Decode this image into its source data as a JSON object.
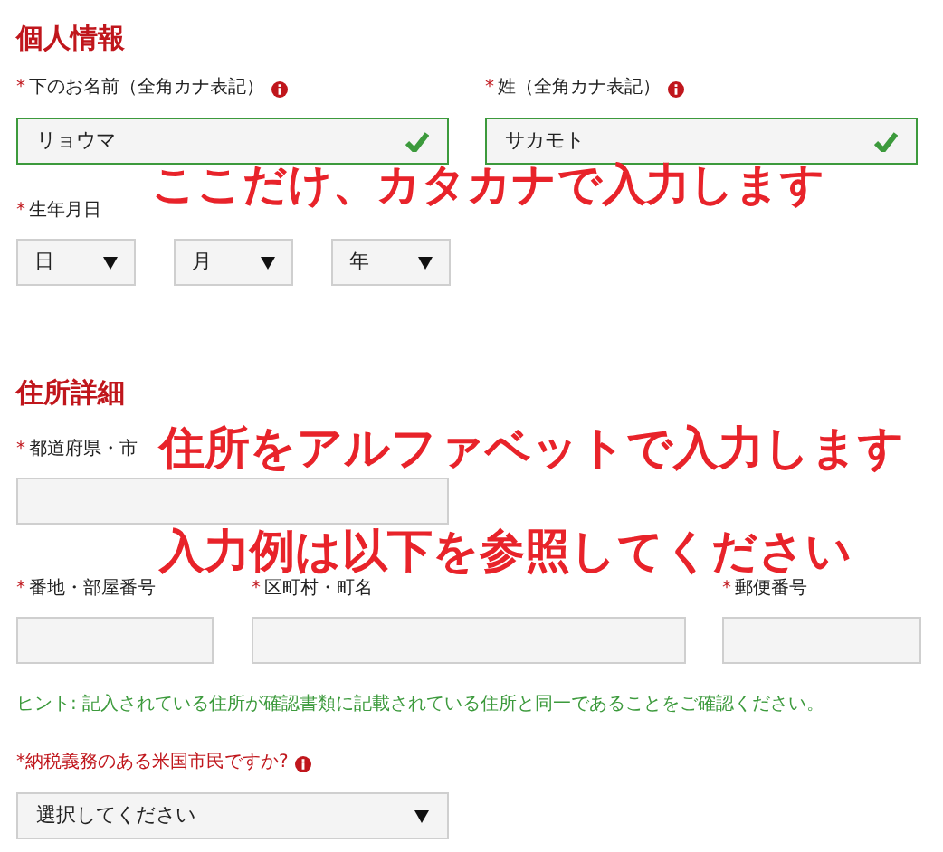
{
  "personal": {
    "title": "個人情報",
    "name_fields": [
      {
        "mark": "*",
        "label": "下のお名前（全角カナ表記）",
        "info": true,
        "value": "リョウマ",
        "valid": true
      },
      {
        "mark": "*",
        "label": "姓（全角カナ表記）",
        "info": true,
        "value": "サカモト",
        "valid": true
      }
    ],
    "birthdate": {
      "mark": "*",
      "label": "生年月日",
      "selects": [
        "日",
        "月",
        "年"
      ]
    },
    "annotation": "ここだけ、カタカナで入力します"
  },
  "address": {
    "title": "住所詳細",
    "city": {
      "mark": "*",
      "label": "都道府県・市"
    },
    "row": [
      {
        "mark": "*",
        "label": "番地・部屋番号"
      },
      {
        "mark": "*",
        "label": "区町村・町名"
      },
      {
        "mark": "*",
        "label": "郵便番号"
      }
    ],
    "annotation_lines": [
      "住所をアルファベットで入力します",
      "入力例は以下を参照してください"
    ],
    "hint": "ヒント: 記入されている住所が確認書類に記載されている住所と同一であることをご確認ください。"
  },
  "tax": {
    "question": "*納税義務のある米国市民ですか?",
    "info": true,
    "select": "選択してください"
  }
}
